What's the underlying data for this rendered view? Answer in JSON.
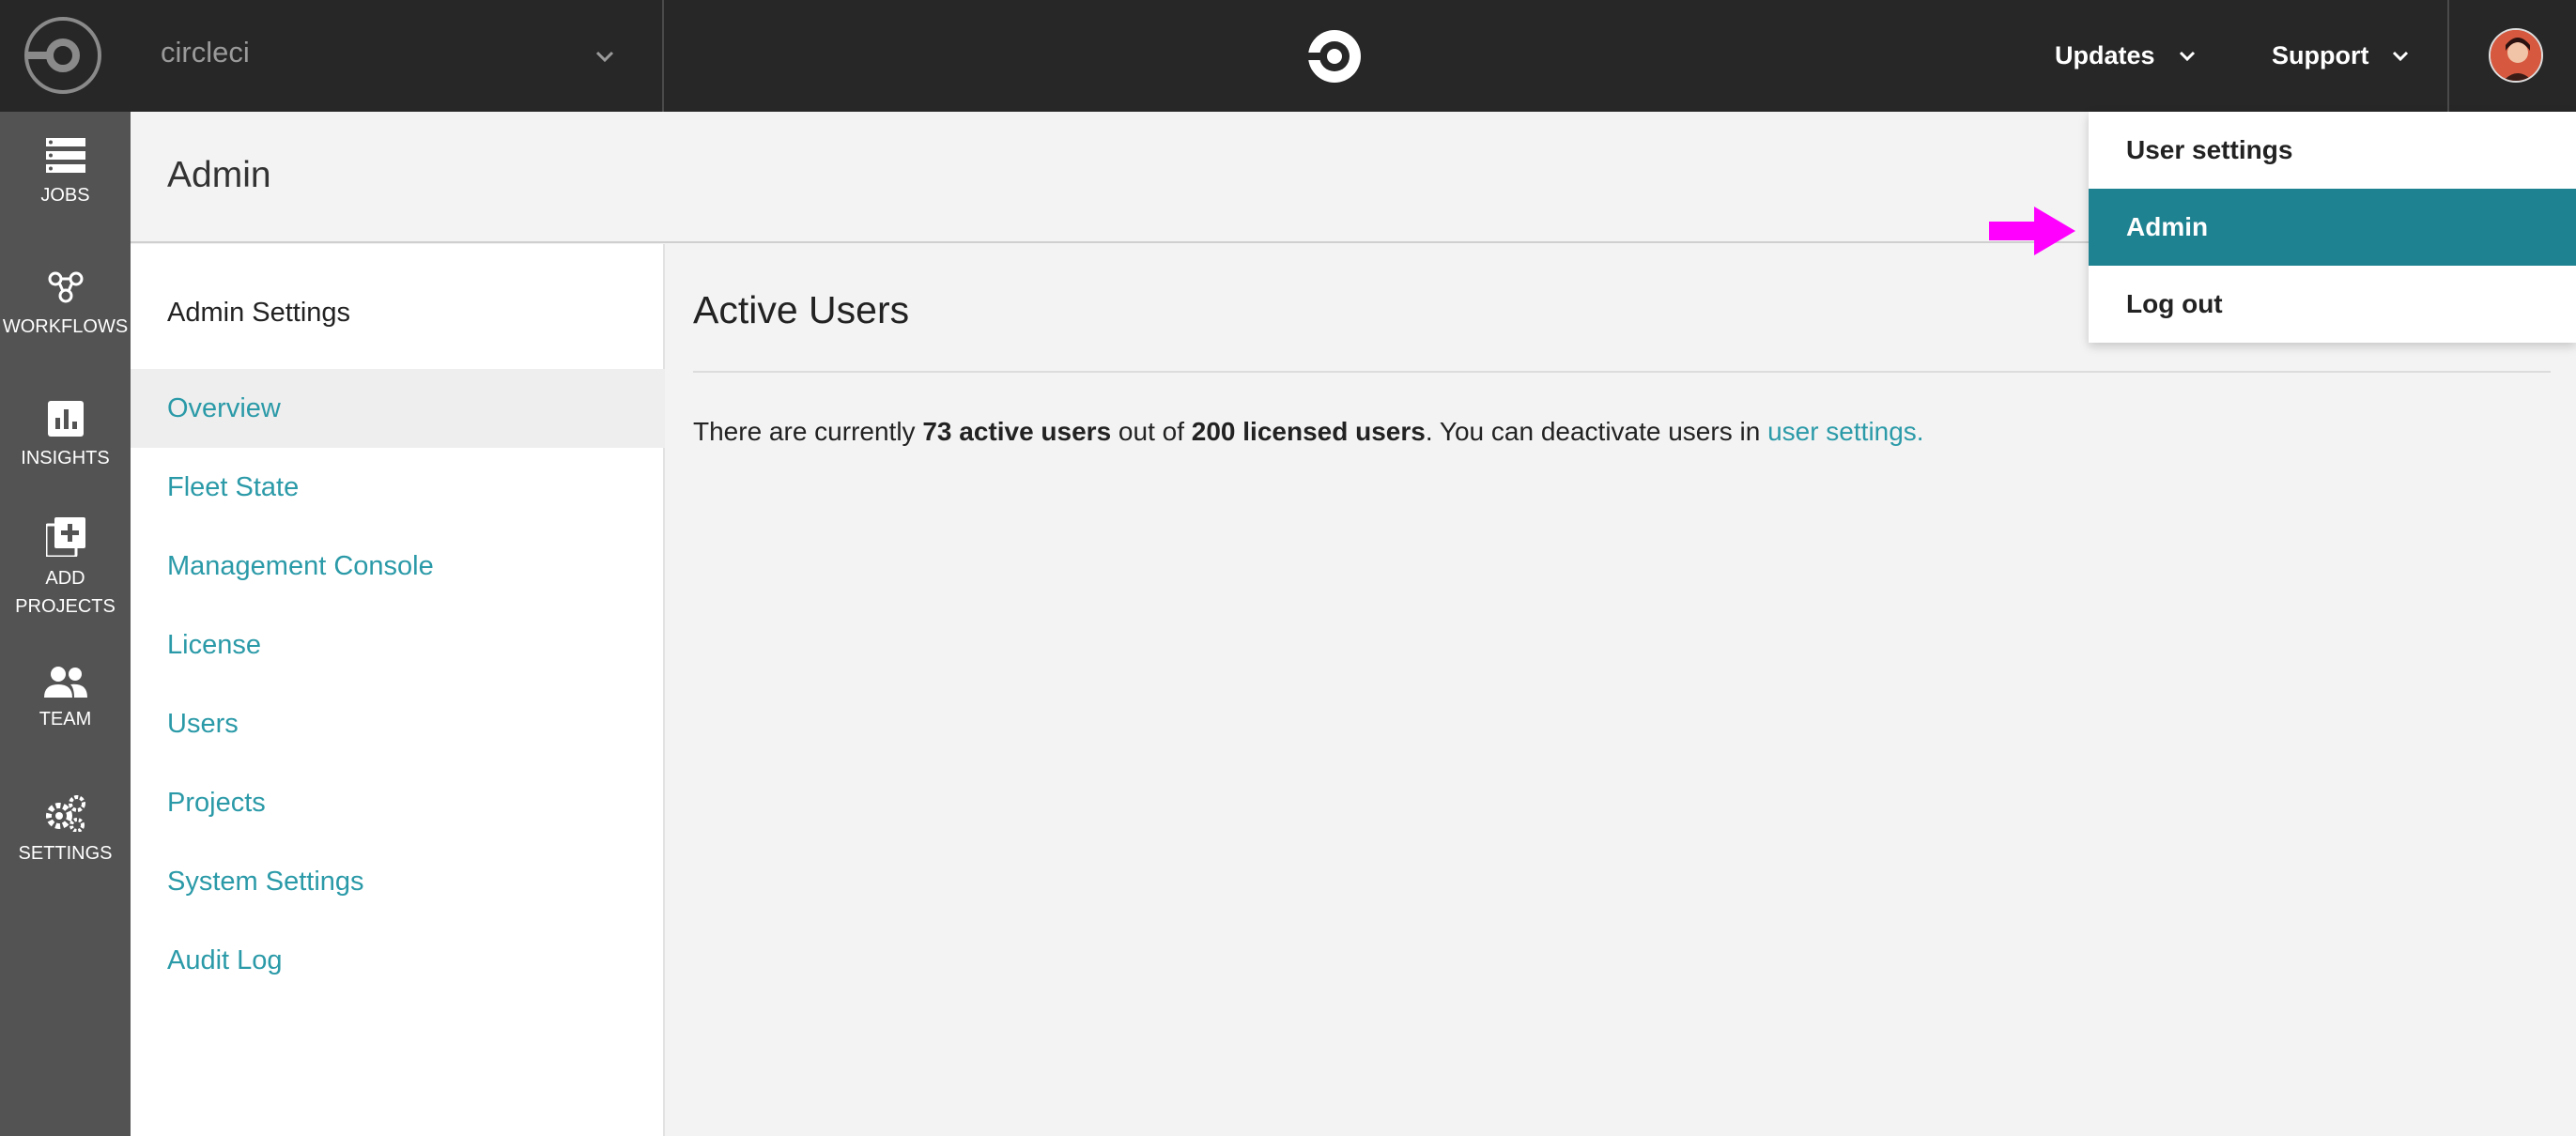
{
  "topbar": {
    "org_name": "circleci",
    "updates_label": "Updates",
    "support_label": "Support"
  },
  "leftnav": {
    "items": [
      {
        "label": "JOBS",
        "icon": "jobs-icon"
      },
      {
        "label": "WORKFLOWS",
        "icon": "workflows-icon"
      },
      {
        "label": "INSIGHTS",
        "icon": "insights-icon"
      },
      {
        "label_line1": "ADD",
        "label_line2": "PROJECTS",
        "icon": "add-projects-icon"
      },
      {
        "label": "TEAM",
        "icon": "team-icon"
      },
      {
        "label": "SETTINGS",
        "icon": "settings-icon"
      }
    ]
  },
  "page": {
    "title": "Admin"
  },
  "settings": {
    "title": "Admin Settings",
    "links": [
      {
        "label": "Overview",
        "active": true
      },
      {
        "label": "Fleet State"
      },
      {
        "label": "Management Console"
      },
      {
        "label": "License"
      },
      {
        "label": "Users"
      },
      {
        "label": "Projects"
      },
      {
        "label": "System Settings"
      },
      {
        "label": "Audit Log"
      }
    ]
  },
  "main": {
    "title": "Active Users",
    "text_prefix": "There are currently ",
    "active_users": "73 active users",
    "text_mid": " out of ",
    "licensed_users": "200 licensed users",
    "text_suffix": ". You can deactivate users in ",
    "link_text": "user settings."
  },
  "user_menu": {
    "items": [
      {
        "label": "User settings"
      },
      {
        "label": "Admin",
        "active": true
      },
      {
        "label": "Log out"
      }
    ]
  },
  "colors": {
    "topbar": "#272727",
    "leftnav": "#535353",
    "link": "#2b9aa8",
    "menu_active": "#1f8291",
    "annotation_arrow": "#ff00ff"
  }
}
